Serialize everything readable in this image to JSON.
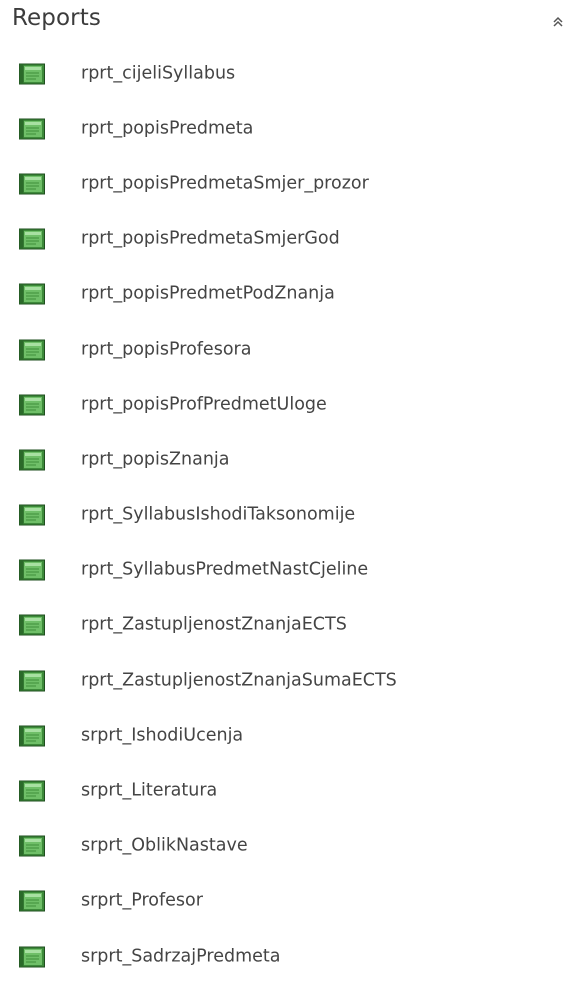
{
  "group": {
    "title": "Reports",
    "collapse_icon": "double-chevron-up-icon"
  },
  "icon_name": "report-icon",
  "colors": {
    "icon_green_dark": "#2f7a2f",
    "icon_green_light": "#7fc97a",
    "text": "#444444"
  },
  "reports": [
    "rprt_cijeliSyllabus",
    "rprt_popisPredmeta",
    "rprt_popisPredmetaSmjer_prozor",
    "rprt_popisPredmetaSmjerGod",
    "rprt_popisPredmetPodZnanja",
    "rprt_popisProfesora",
    "rprt_popisProfPredmetUloge",
    "rprt_popisZnanja",
    "rprt_SyllabusIshodiTaksonomije",
    "rprt_SyllabusPredmetNastCjeline",
    "rprt_ZastupljenostZnanjaECTS",
    "rprt_ZastupljenostZnanjaSumaECTS",
    "srprt_IshodiUcenja",
    "srprt_Literatura",
    "srprt_OblikNastave",
    "srprt_Profesor",
    "srprt_SadrzajPredmeta"
  ]
}
